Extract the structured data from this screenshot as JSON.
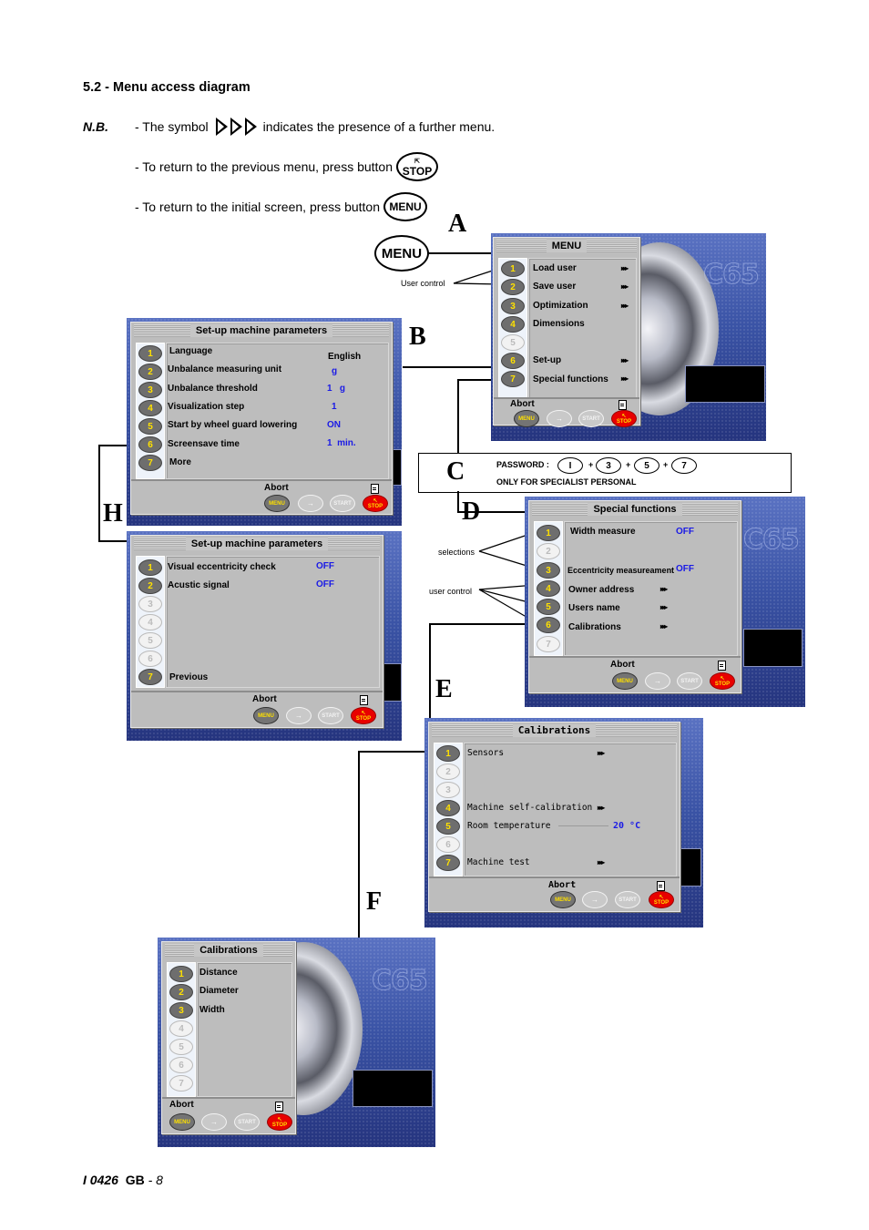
{
  "heading": "5.2 - Menu access diagram",
  "notes": {
    "nb_label": "N.B.",
    "symbol_prefix": "- The symbol",
    "symbol_icon": "triple-play-arrow-icon",
    "symbol_suffix": "indicates the presence of a further menu.",
    "previous_menu": "- To return to the previous menu, press button",
    "initial_screen": "- To return to the initial screen, press button",
    "stop_button_label": "STOP",
    "menu_button_label": "MENU"
  },
  "letters": {
    "A": "A",
    "B": "B",
    "C": "C",
    "D": "D",
    "E": "E",
    "F": "F",
    "H": "H"
  },
  "menu_key": "MENU",
  "callouts": {
    "user_control_a": "User control",
    "selections": "selections",
    "user_control_d": "user control"
  },
  "password": {
    "label": "PASSWORD :",
    "keys": [
      "I",
      "3",
      "5",
      "7"
    ],
    "plus": "+",
    "note": "ONLY FOR SPECIALIST PERSONAL"
  },
  "common": {
    "abort": "Abort",
    "btn_menu": "MENU",
    "btn_arrow": "→",
    "btn_start": "START",
    "btn_stop": "STOP",
    "more_arrow": "▸▸▸",
    "logo": "C65"
  },
  "screens": {
    "A": {
      "title": "MENU",
      "numbers": [
        {
          "n": "1",
          "active": true
        },
        {
          "n": "2",
          "active": true
        },
        {
          "n": "3",
          "active": true
        },
        {
          "n": "4",
          "active": true
        },
        {
          "n": "5",
          "active": false
        },
        {
          "n": "6",
          "active": true
        },
        {
          "n": "7",
          "active": true
        }
      ],
      "items": [
        {
          "label": "Load user",
          "submenu": true
        },
        {
          "label": "Save user",
          "submenu": true
        },
        {
          "label": "Optimization",
          "submenu": true
        },
        {
          "label": "Dimensions",
          "submenu": false
        },
        {
          "label": "",
          "submenu": false
        },
        {
          "label": "Set-up",
          "submenu": true
        },
        {
          "label": "Special functions",
          "submenu": true
        }
      ]
    },
    "B": {
      "title": "Set-up machine parameters",
      "items": [
        {
          "n": "1",
          "label": "Language",
          "value": "English",
          "value_color": "#000000"
        },
        {
          "n": "2",
          "label": "Unbalance measuring unit",
          "value": "g"
        },
        {
          "n": "3",
          "label": "Unbalance threshold",
          "value": "1   g"
        },
        {
          "n": "4",
          "label": "Visualization step",
          "value": "1"
        },
        {
          "n": "5",
          "label": "Start by wheel guard lowering",
          "value": "ON"
        },
        {
          "n": "6",
          "label": "Screensave time",
          "value": "1  min."
        },
        {
          "n": "7",
          "label": "More",
          "value": ""
        }
      ]
    },
    "H": {
      "title": "Set-up machine parameters",
      "items": [
        {
          "n": "1",
          "active": true,
          "label": "Visual eccentricity check",
          "value": "OFF"
        },
        {
          "n": "2",
          "active": true,
          "label": "Acustic signal",
          "value": "OFF"
        },
        {
          "n": "3",
          "active": false,
          "label": "",
          "value": ""
        },
        {
          "n": "4",
          "active": false,
          "label": "",
          "value": ""
        },
        {
          "n": "5",
          "active": false,
          "label": "",
          "value": ""
        },
        {
          "n": "6",
          "active": false,
          "label": "",
          "value": ""
        },
        {
          "n": "7",
          "active": true,
          "label": "Previous",
          "value": ""
        }
      ]
    },
    "D": {
      "title": "Special functions",
      "items": [
        {
          "n": "1",
          "active": true,
          "label": "Width measure",
          "value": "OFF",
          "submenu": false
        },
        {
          "n": "2",
          "active": false,
          "label": "",
          "value": "",
          "submenu": false
        },
        {
          "n": "3",
          "active": true,
          "label": "Eccentricity measureament",
          "value": "OFF",
          "submenu": false
        },
        {
          "n": "4",
          "active": true,
          "label": "Owner address",
          "value": "",
          "submenu": true
        },
        {
          "n": "5",
          "active": true,
          "label": "Users name",
          "value": "",
          "submenu": true
        },
        {
          "n": "6",
          "active": true,
          "label": "Calibrations",
          "value": "",
          "submenu": true
        },
        {
          "n": "7",
          "active": false,
          "label": "",
          "value": "",
          "submenu": false
        }
      ]
    },
    "E": {
      "title": "Calibrations",
      "items": [
        {
          "n": "1",
          "active": true,
          "label": "Sensors",
          "value": "",
          "submenu": true
        },
        {
          "n": "2",
          "active": false,
          "label": "",
          "value": "",
          "submenu": false
        },
        {
          "n": "3",
          "active": false,
          "label": "",
          "value": "",
          "submenu": false
        },
        {
          "n": "4",
          "active": true,
          "label": "Machine self-calibration",
          "value": "",
          "submenu": true
        },
        {
          "n": "5",
          "active": true,
          "label": "Room temperature",
          "value": "20 °C",
          "submenu": false
        },
        {
          "n": "6",
          "active": false,
          "label": "",
          "value": "",
          "submenu": false
        },
        {
          "n": "7",
          "active": true,
          "label": "Machine test",
          "value": "",
          "submenu": true
        }
      ]
    },
    "F": {
      "title": "Calibrations",
      "items": [
        {
          "n": "1",
          "active": true,
          "label": "Distance"
        },
        {
          "n": "2",
          "active": true,
          "label": "Diameter"
        },
        {
          "n": "3",
          "active": true,
          "label": "Width"
        },
        {
          "n": "4",
          "active": false,
          "label": ""
        },
        {
          "n": "5",
          "active": false,
          "label": ""
        },
        {
          "n": "6",
          "active": false,
          "label": ""
        },
        {
          "n": "7",
          "active": false,
          "label": ""
        }
      ]
    }
  },
  "footer": {
    "doc_code": "I 0426",
    "lang": "GB",
    "page_sep": " - ",
    "page": "8"
  }
}
